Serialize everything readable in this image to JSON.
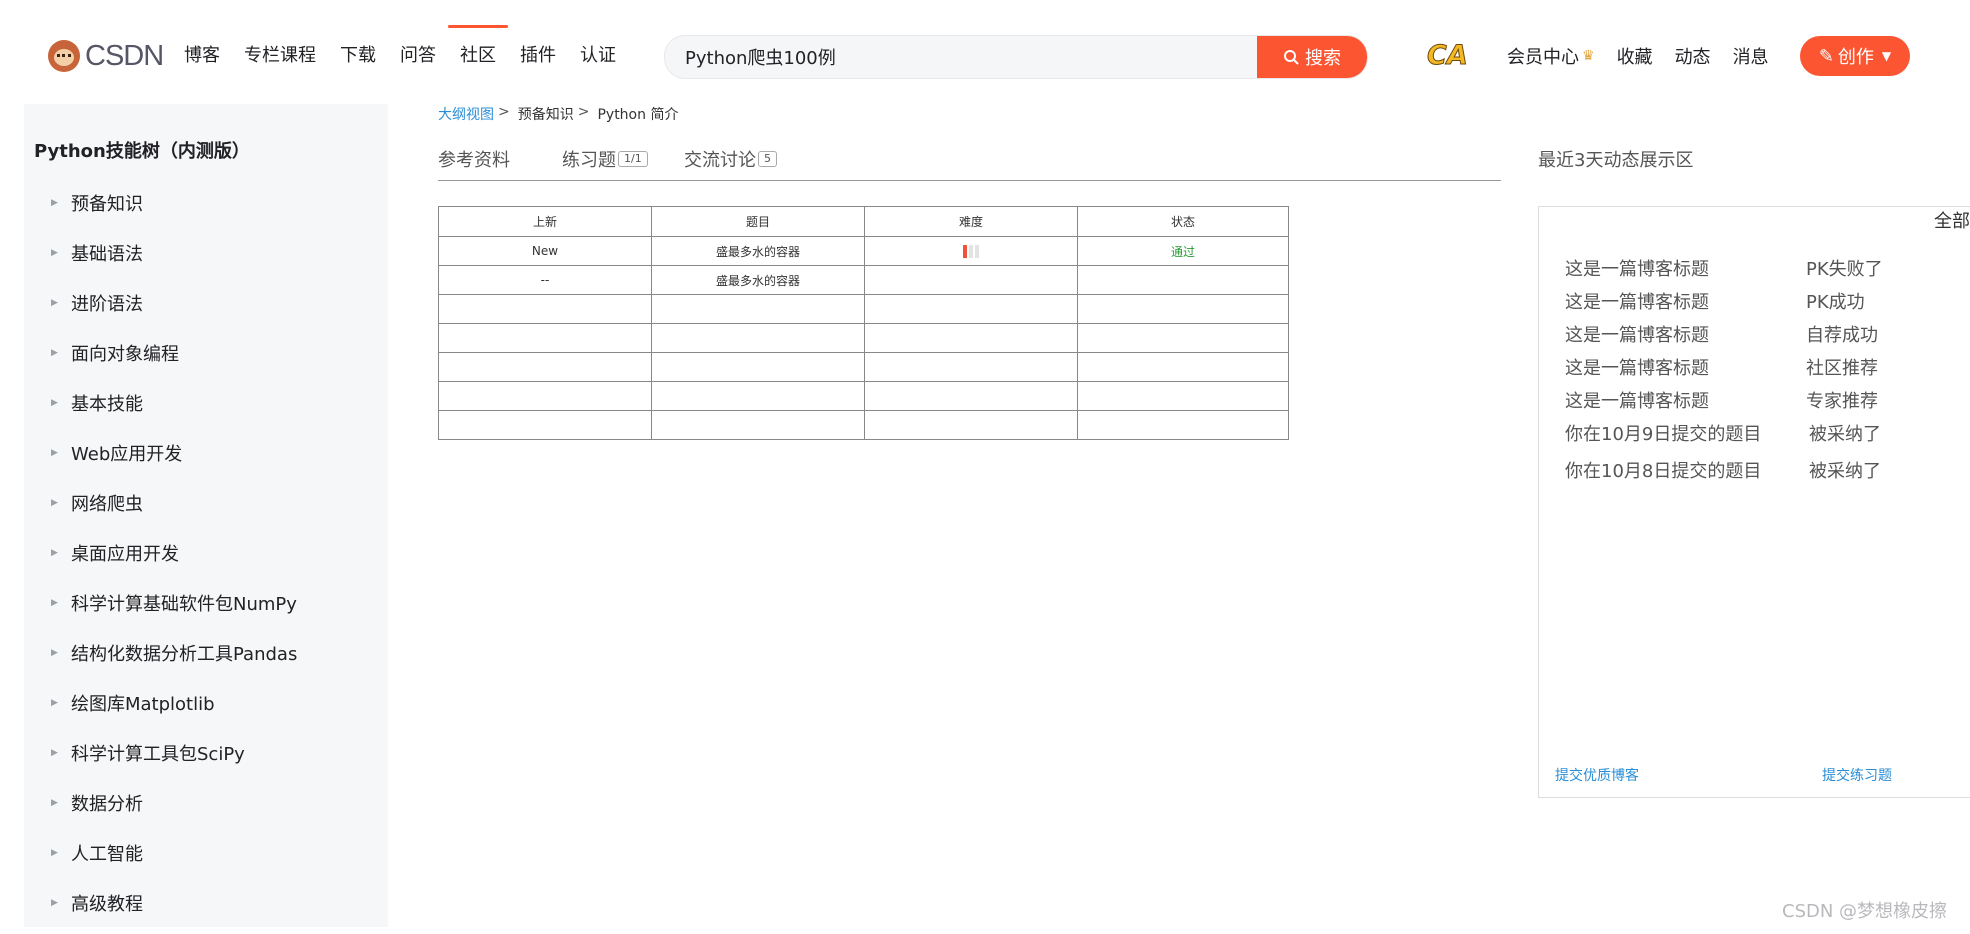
{
  "header": {
    "logo_text": "CSDN",
    "nav": [
      "博客",
      "专栏课程",
      "下载",
      "问答",
      "社区",
      "插件",
      "认证"
    ],
    "active_nav": "社区",
    "search": {
      "value": "Python爬虫100例",
      "button": "搜索"
    },
    "ca_logo": "CA",
    "toolbar": [
      "会员中心",
      "收藏",
      "动态",
      "消息"
    ],
    "create_button": "创作"
  },
  "sidebar": {
    "title": "Python技能树（内测版）",
    "items": [
      "预备知识",
      "基础语法",
      "进阶语法",
      "面向对象编程",
      "基本技能",
      "Web应用开发",
      "网络爬虫",
      "桌面应用开发",
      "科学计算基础软件包NumPy",
      "结构化数据分析工具Pandas",
      "绘图库Matplotlib",
      "科学计算工具包SciPy",
      "数据分析",
      "人工智能",
      "高级教程"
    ]
  },
  "breadcrumb": {
    "link": "大纲视图",
    "sep": ">",
    "mid": "预备知识",
    "current": "Python 简介"
  },
  "tabs": [
    {
      "label": "参考资料",
      "badge": ""
    },
    {
      "label": "练习题",
      "badge": "1/1"
    },
    {
      "label": "交流讨论",
      "badge": "5"
    }
  ],
  "table": {
    "headers": [
      "上新",
      "题目",
      "难度",
      "状态"
    ],
    "rows": [
      {
        "new": "New",
        "title": "盛最多水的容器",
        "difficulty": 1,
        "status": "通过"
      },
      {
        "new": "--",
        "title": "盛最多水的容器",
        "difficulty": null,
        "status": ""
      },
      {
        "new": "",
        "title": "",
        "difficulty": null,
        "status": ""
      },
      {
        "new": "",
        "title": "",
        "difficulty": null,
        "status": ""
      },
      {
        "new": "",
        "title": "",
        "difficulty": null,
        "status": ""
      },
      {
        "new": "",
        "title": "",
        "difficulty": null,
        "status": ""
      },
      {
        "new": "",
        "title": "",
        "difficulty": null,
        "status": ""
      }
    ],
    "difficulty_max": 3
  },
  "activity": {
    "title": "最近3天动态展示区",
    "all_label": "全部",
    "items": [
      {
        "title": "这是一篇博客标题",
        "status": "PK失败了"
      },
      {
        "title": "这是一篇博客标题",
        "status": "PK成功"
      },
      {
        "title": "这是一篇博客标题",
        "status": "自荐成功"
      },
      {
        "title": "这是一篇博客标题",
        "status": "社区推荐"
      },
      {
        "title": "这是一篇博客标题",
        "status": "专家推荐"
      },
      {
        "title": "你在10月9日提交的题目",
        "status": "被采纳了"
      },
      {
        "title": "你在10月8日提交的题目",
        "status": "被采纳了"
      }
    ],
    "footer_blog": "提交优质博客",
    "footer_exercise": "提交练习题"
  },
  "watermark": "CSDN @梦想橡皮擦",
  "colors": {
    "brand": "#fc5531",
    "link": "#2a8ed6",
    "pass": "#2a9b36"
  }
}
